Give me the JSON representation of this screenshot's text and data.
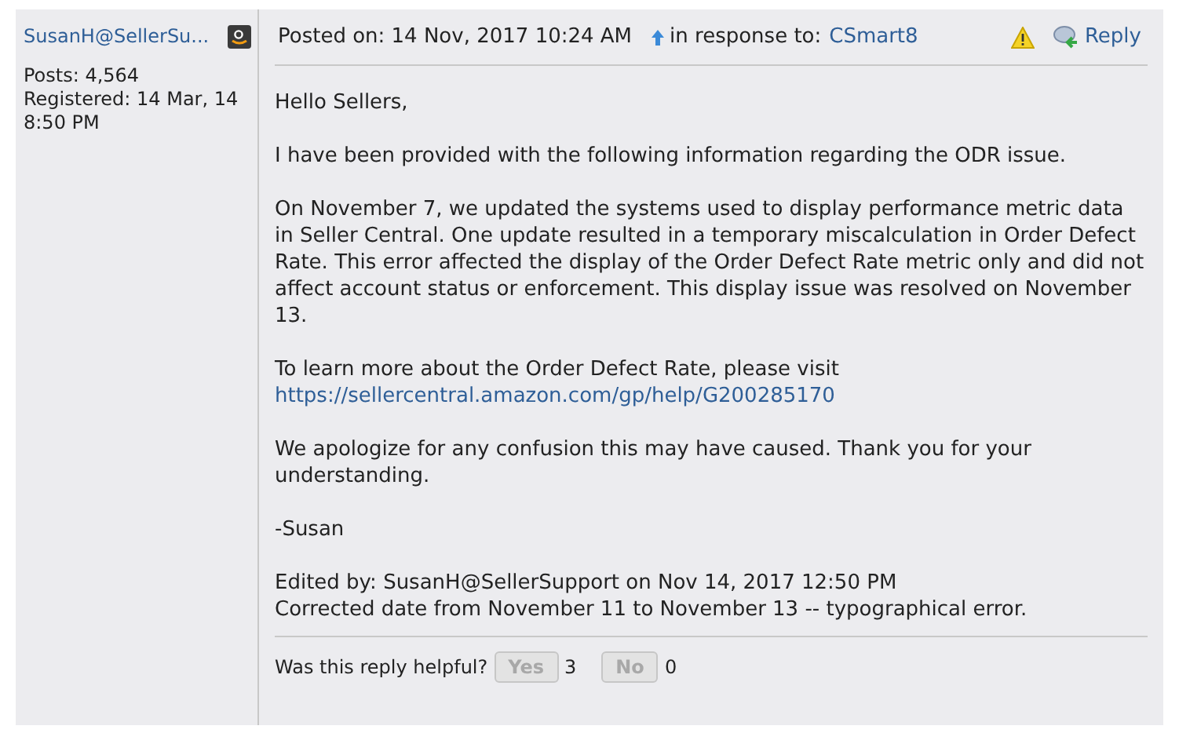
{
  "author": {
    "name": "SusanH@SellerSu...",
    "stats": [
      "Posts: 4,564",
      "Registered: 14 Mar, 14 8:50 PM"
    ]
  },
  "post": {
    "posted_on": "Posted on: 14 Nov, 2017 10:24 AM",
    "in_response_label": "in response to:",
    "in_response_to": "CSmart8",
    "reply": "Reply",
    "body": [
      {
        "kind": "text",
        "text": "Hello Sellers,"
      },
      {
        "kind": "text",
        "text": "I have been provided with the following information regarding the ODR issue."
      },
      {
        "kind": "text",
        "text": "On November 7, we updated the systems used to display performance metric data in Seller Central. One update resulted in a temporary miscalculation in Order Defect Rate. This error affected the display of the Order Defect Rate metric only and did not affect account status or enforcement. This display issue was resolved on November 13."
      },
      {
        "kind": "link",
        "text": "To learn more about the Order Defect Rate, please visit",
        "link": "https://sellercentral.amazon.com/gp/help/G200285170"
      },
      {
        "kind": "text",
        "text": "We apologize for any confusion this may have caused. Thank you for your understanding."
      },
      {
        "kind": "text",
        "text": "-Susan"
      },
      {
        "kind": "edit",
        "text": "Edited by: SusanH@SellerSupport on Nov 14, 2017 12:50 PM",
        "note": "Corrected date from November 11 to November 13 -- typographical error."
      }
    ]
  },
  "feedback": {
    "question": "Was this reply helpful?",
    "votes": [
      {
        "label": "Yes",
        "count": "3",
        "disabled": true
      },
      {
        "label": "No",
        "count": "0",
        "disabled": true
      }
    ]
  }
}
